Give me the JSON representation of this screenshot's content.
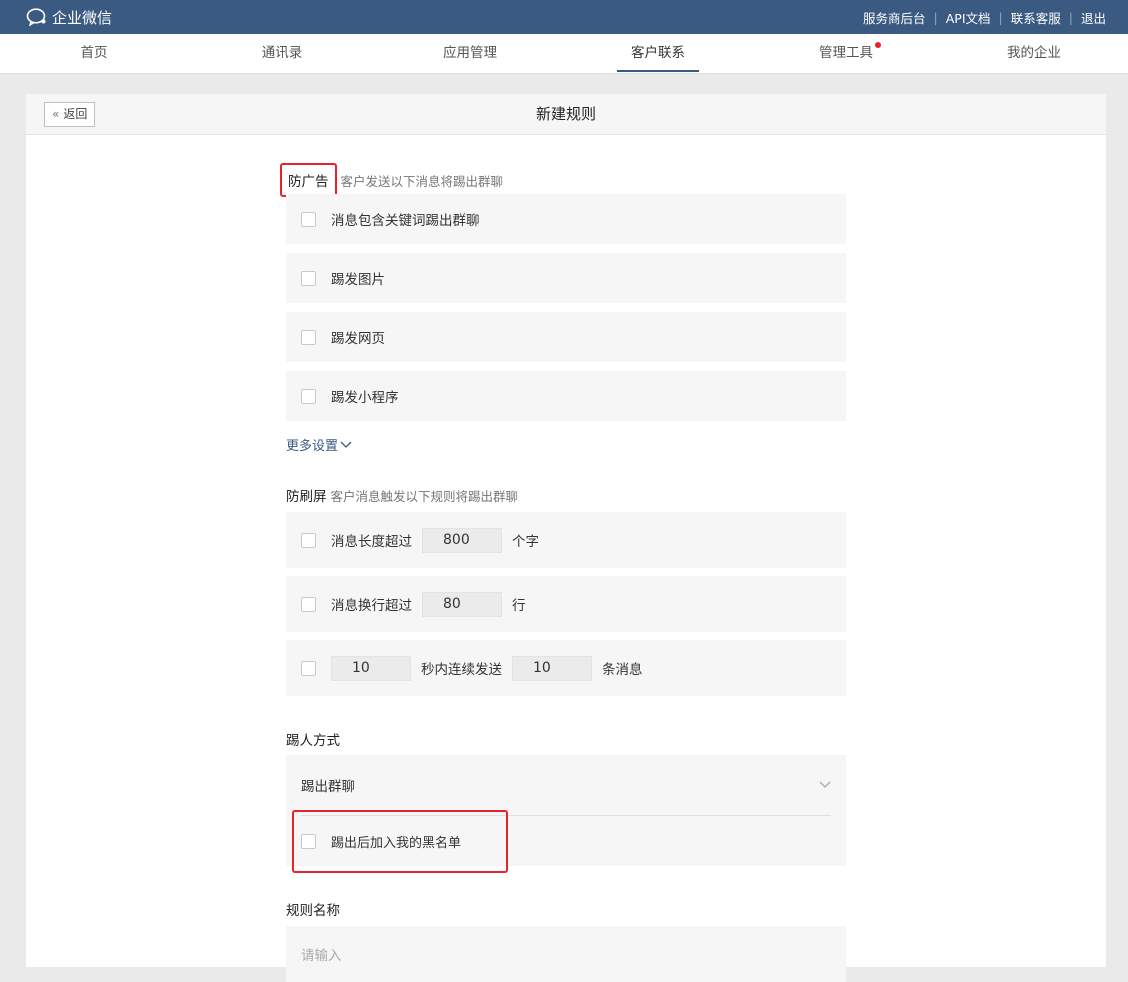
{
  "topbar": {
    "brand": "企业微信",
    "links": [
      "服务商后台",
      "API文档",
      "联系客服",
      "退出"
    ]
  },
  "nav": {
    "items": [
      "首页",
      "通讯录",
      "应用管理",
      "客户联系",
      "管理工具",
      "我的企业"
    ],
    "active": "客户联系",
    "badge_on": "管理工具"
  },
  "page": {
    "back_label": "返回",
    "title": "新建规则"
  },
  "anti_ad": {
    "title": "防广告",
    "desc": "客户发送以下消息将踢出群聊",
    "options": [
      "消息包含关键词踢出群聊",
      "踢发图片",
      "踢发网页",
      "踢发小程序"
    ],
    "more_label": "更多设置"
  },
  "anti_spam": {
    "title": "防刷屏",
    "desc": "客户消息触发以下规则将踢出群聊",
    "length_prefix": "消息长度超过",
    "length_value": "800",
    "length_unit": "个字",
    "lines_prefix": "消息换行超过",
    "lines_value": "80",
    "lines_unit": "行",
    "burst_seconds": "10",
    "burst_mid": "秒内连续发送",
    "burst_count": "10",
    "burst_unit": "条消息"
  },
  "kick": {
    "title": "踢人方式",
    "selected": "踢出群聊",
    "blacklist_label": "踢出后加入我的黑名单"
  },
  "rule_name": {
    "title": "规则名称",
    "placeholder": "请输入"
  },
  "colors": {
    "topbar": "#3a5a82",
    "highlight": "#e8232b",
    "row_bg": "#f6f6f6"
  }
}
